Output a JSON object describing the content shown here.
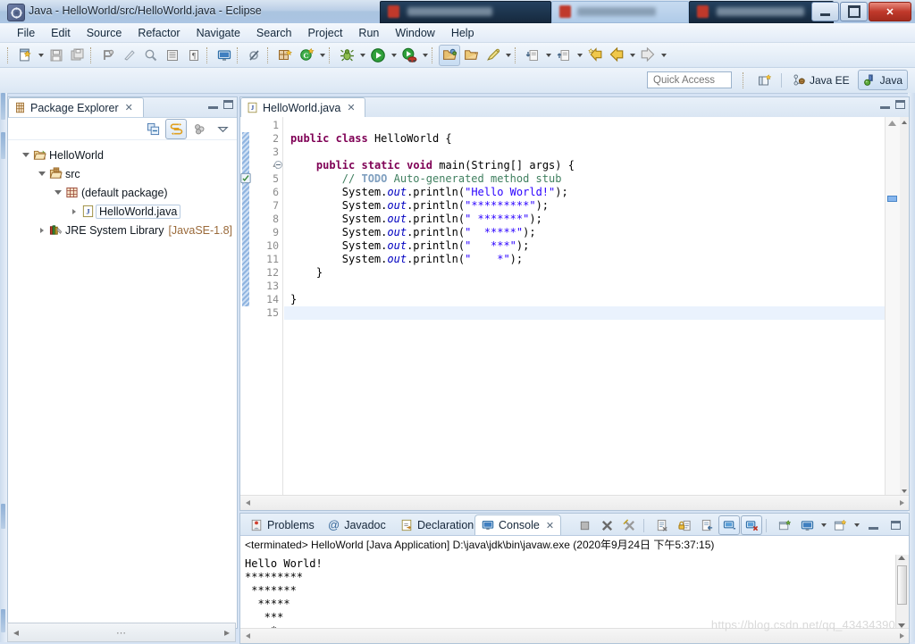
{
  "window": {
    "title": "Java - HelloWorld/src/HelloWorld.java - Eclipse",
    "app_icon": "eclipse-icon",
    "minimize_label": "",
    "maximize_label": "",
    "close_label": "✕"
  },
  "menubar": {
    "items": [
      {
        "label": "File",
        "name": "menu-file"
      },
      {
        "label": "Edit",
        "name": "menu-edit"
      },
      {
        "label": "Source",
        "name": "menu-source"
      },
      {
        "label": "Refactor",
        "name": "menu-refactor"
      },
      {
        "label": "Navigate",
        "name": "menu-navigate"
      },
      {
        "label": "Search",
        "name": "menu-search"
      },
      {
        "label": "Project",
        "name": "menu-project"
      },
      {
        "label": "Run",
        "name": "menu-run"
      },
      {
        "label": "Window",
        "name": "menu-window"
      },
      {
        "label": "Help",
        "name": "menu-help"
      }
    ]
  },
  "quick_access": {
    "placeholder": "Quick Access",
    "value": ""
  },
  "perspectives": {
    "open_perspective_label": "",
    "items": [
      {
        "label": "Java EE",
        "active": false
      },
      {
        "label": "Java",
        "active": true
      }
    ]
  },
  "package_explorer": {
    "tab_label": "Package Explorer",
    "close_label": "✕",
    "tree": [
      {
        "label": "HelloWorld",
        "icon": "project-icon",
        "depth": 0,
        "expanded": true,
        "selected": false,
        "suffix": ""
      },
      {
        "label": "src",
        "icon": "source-folder-icon",
        "depth": 1,
        "expanded": true,
        "selected": false,
        "suffix": ""
      },
      {
        "label": "(default package)",
        "icon": "package-icon",
        "depth": 2,
        "expanded": true,
        "selected": false,
        "suffix": ""
      },
      {
        "label": "HelloWorld.java",
        "icon": "java-file-icon",
        "depth": 3,
        "expanded": false,
        "selected": true,
        "suffix": ""
      },
      {
        "label": "JRE System Library",
        "icon": "library-icon",
        "depth": 1,
        "expanded": false,
        "selected": false,
        "suffix": "[JavaSE-1.8]"
      }
    ]
  },
  "editor": {
    "tab_label": "HelloWorld.java",
    "close_label": "✕",
    "total_lines": 15,
    "current_line": 15,
    "lines": [
      {
        "no": 1,
        "text": "",
        "changed": false
      },
      {
        "no": 2,
        "text": "public class HelloWorld {",
        "changed": true
      },
      {
        "no": 3,
        "text": "",
        "changed": true
      },
      {
        "no": 4,
        "text": "    public static void main(String[] args) {",
        "changed": true,
        "fold": true
      },
      {
        "no": 5,
        "text": "        // TODO Auto-generated method stub",
        "changed": true,
        "marker": "todo-marker-icon"
      },
      {
        "no": 6,
        "text": "        System.out.println(\"Hello World!\");",
        "changed": true
      },
      {
        "no": 7,
        "text": "        System.out.println(\"*********\");",
        "changed": true
      },
      {
        "no": 8,
        "text": "        System.out.println(\" *******\");",
        "changed": true
      },
      {
        "no": 9,
        "text": "        System.out.println(\"  *****\");",
        "changed": true
      },
      {
        "no": 10,
        "text": "        System.out.println(\"   ***\");",
        "changed": true
      },
      {
        "no": 11,
        "text": "        System.out.println(\"    *\");",
        "changed": true
      },
      {
        "no": 12,
        "text": "    }",
        "changed": true
      },
      {
        "no": 13,
        "text": "",
        "changed": true
      },
      {
        "no": 14,
        "text": "}",
        "changed": true
      },
      {
        "no": 15,
        "text": "",
        "changed": false
      }
    ]
  },
  "bottom_panel": {
    "tabs": [
      {
        "label": "Problems",
        "icon": "problems-icon",
        "selected": false
      },
      {
        "label": "Javadoc",
        "icon": "javadoc-icon",
        "selected": false
      },
      {
        "label": "Declaration",
        "icon": "declaration-icon",
        "selected": false
      },
      {
        "label": "Console",
        "icon": "console-icon",
        "selected": true
      }
    ],
    "close_label": "✕",
    "console_title": "<terminated> HelloWorld [Java Application] D:\\java\\jdk\\bin\\javaw.exe (2020年9月24日 下午5:37:15)",
    "console_output": "Hello World!\n*********\n *******\n  *****\n   ***\n    *"
  },
  "watermark": {
    "text": "https://blog.csdn.net/qq_43434390"
  },
  "colors": {
    "accent": "#2a00ff",
    "keyword": "#7f0055",
    "comment": "#3f7f5f",
    "field": "#0000c0",
    "selection": "#eaf2fd",
    "title_bar": "#9fbbdd"
  }
}
